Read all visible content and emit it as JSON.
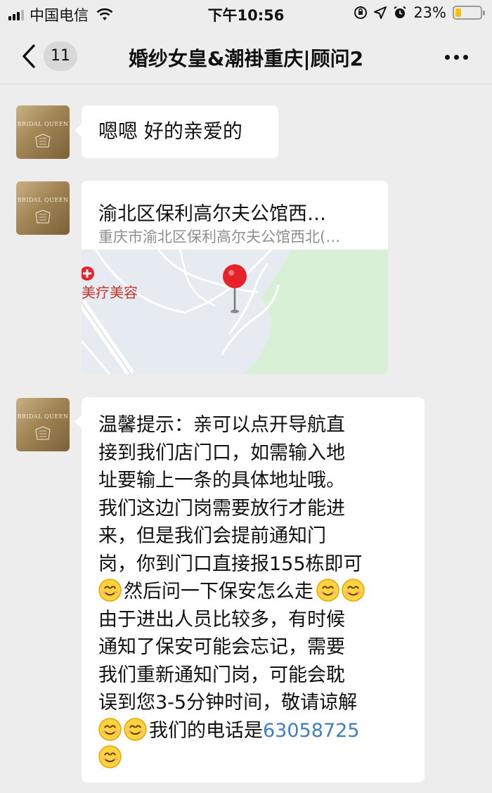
{
  "status_bar": {
    "carrier": "中国电信",
    "time": "下午10:56",
    "battery_percent": "23%",
    "battery_level": 0.23
  },
  "nav": {
    "unread_count": "11",
    "title": "婚纱女皇&潮褂重庆|顾问2"
  },
  "avatar": {
    "brand": "BRIDAL QUEEN"
  },
  "messages": [
    {
      "type": "text",
      "text": "嗯嗯 好的亲爱的"
    },
    {
      "type": "location",
      "title": "渝北区保利高尔夫公馆西…",
      "address": "重庆市渝北区保利高尔夫公馆西北(…",
      "map_label": "美疗美容"
    },
    {
      "type": "text",
      "lines": [
        "温馨提示：亲可以点开导航直",
        "接到我们店门口，如需输入地",
        "址要输上一条的具体地址哦。",
        "我们这边门岗需要放行才能进",
        "来，但是我们会提前通知门",
        "岗，你到门口直接报155栋即可",
        "然后问一下保安怎么走",
        "由于进出人员比较多，有时候",
        "通知了保安可能会忘记，需要",
        "我们重新通知门岗，可能会耽",
        "误到您3-5分钟时间，敬请谅解",
        "我们的电话是",
        "63058725"
      ]
    }
  ],
  "colors": {
    "background": "#ededed",
    "bubble": "#ffffff",
    "link": "#3f7fbd",
    "map_pin": "#e8222a"
  }
}
